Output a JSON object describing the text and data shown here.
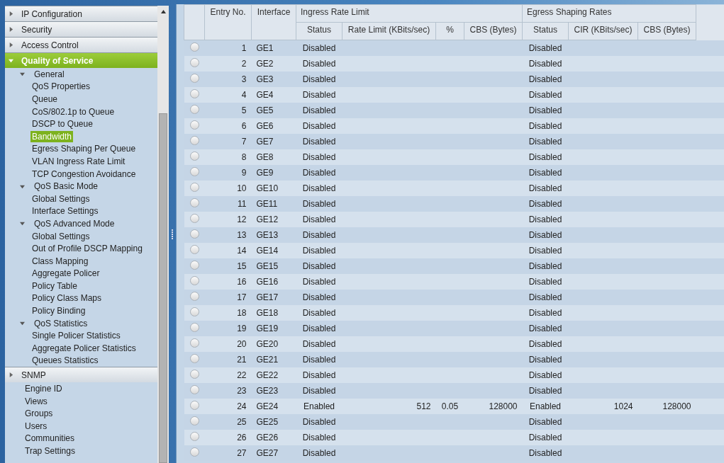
{
  "sidebar": {
    "sections": [
      {
        "label": "IP Configuration",
        "expanded": false,
        "selected": false
      },
      {
        "label": "Security",
        "expanded": false,
        "selected": false
      },
      {
        "label": "Access Control",
        "expanded": false,
        "selected": false
      },
      {
        "label": "Quality of Service",
        "expanded": true,
        "selected": true,
        "items": [
          {
            "label": "General",
            "expanded": true,
            "children": [
              {
                "label": "QoS Properties",
                "selected": false
              },
              {
                "label": "Queue",
                "selected": false
              },
              {
                "label": "CoS/802.1p to Queue",
                "selected": false
              },
              {
                "label": "DSCP to Queue",
                "selected": false
              },
              {
                "label": "Bandwidth",
                "selected": true
              },
              {
                "label": "Egress Shaping Per Queue",
                "selected": false
              },
              {
                "label": "VLAN Ingress Rate Limit",
                "selected": false
              },
              {
                "label": "TCP Congestion Avoidance",
                "selected": false
              }
            ]
          },
          {
            "label": "QoS Basic Mode",
            "expanded": true,
            "children": [
              {
                "label": "Global Settings",
                "selected": false
              },
              {
                "label": "Interface Settings",
                "selected": false
              }
            ]
          },
          {
            "label": "QoS Advanced Mode",
            "expanded": true,
            "children": [
              {
                "label": "Global Settings",
                "selected": false
              },
              {
                "label": "Out of Profile DSCP Mapping",
                "selected": false
              },
              {
                "label": "Class Mapping",
                "selected": false
              },
              {
                "label": "Aggregate Policer",
                "selected": false
              },
              {
                "label": "Policy Table",
                "selected": false
              },
              {
                "label": "Policy Class Maps",
                "selected": false
              },
              {
                "label": "Policy Binding",
                "selected": false
              }
            ]
          },
          {
            "label": "QoS Statistics",
            "expanded": true,
            "children": [
              {
                "label": "Single Policer Statistics",
                "selected": false
              },
              {
                "label": "Aggregate Policer Statistics",
                "selected": false
              },
              {
                "label": "Queues Statistics",
                "selected": false
              }
            ]
          }
        ]
      },
      {
        "label": "SNMP",
        "expanded": false,
        "selected": false,
        "items": [
          {
            "label": "Engine ID",
            "selected": false
          },
          {
            "label": "Views",
            "selected": false
          },
          {
            "label": "Groups",
            "selected": false
          },
          {
            "label": "Users",
            "selected": false
          },
          {
            "label": "Communities",
            "selected": false
          },
          {
            "label": "Trap Settings",
            "selected": false
          }
        ]
      }
    ]
  },
  "table": {
    "columns": [
      "Entry No.",
      "Interface"
    ],
    "groups": [
      {
        "label": "Ingress Rate Limit",
        "columns": [
          "Status",
          "Rate Limit (KBits/sec)",
          "%",
          "CBS (Bytes)"
        ]
      },
      {
        "label": "Egress Shaping Rates",
        "columns": [
          "Status",
          "CIR (KBits/sec)",
          "CBS (Bytes)"
        ]
      }
    ],
    "rows": [
      {
        "selected": false,
        "entry": "1",
        "interface": "GE1",
        "ingress_status": "Disabled",
        "egress_status": "Disabled"
      },
      {
        "selected": false,
        "entry": "2",
        "interface": "GE2",
        "ingress_status": "Disabled",
        "egress_status": "Disabled"
      },
      {
        "selected": false,
        "entry": "3",
        "interface": "GE3",
        "ingress_status": "Disabled",
        "egress_status": "Disabled"
      },
      {
        "selected": false,
        "entry": "4",
        "interface": "GE4",
        "ingress_status": "Disabled",
        "egress_status": "Disabled"
      },
      {
        "selected": false,
        "entry": "5",
        "interface": "GE5",
        "ingress_status": "Disabled",
        "egress_status": "Disabled"
      },
      {
        "selected": false,
        "entry": "6",
        "interface": "GE6",
        "ingress_status": "Disabled",
        "egress_status": "Disabled"
      },
      {
        "selected": false,
        "entry": "7",
        "interface": "GE7",
        "ingress_status": "Disabled",
        "egress_status": "Disabled"
      },
      {
        "selected": false,
        "entry": "8",
        "interface": "GE8",
        "ingress_status": "Disabled",
        "egress_status": "Disabled"
      },
      {
        "selected": false,
        "entry": "9",
        "interface": "GE9",
        "ingress_status": "Disabled",
        "egress_status": "Disabled"
      },
      {
        "selected": false,
        "entry": "10",
        "interface": "GE10",
        "ingress_status": "Disabled",
        "egress_status": "Disabled"
      },
      {
        "selected": false,
        "entry": "11",
        "interface": "GE11",
        "ingress_status": "Disabled",
        "egress_status": "Disabled"
      },
      {
        "selected": false,
        "entry": "12",
        "interface": "GE12",
        "ingress_status": "Disabled",
        "egress_status": "Disabled"
      },
      {
        "selected": false,
        "entry": "13",
        "interface": "GE13",
        "ingress_status": "Disabled",
        "egress_status": "Disabled"
      },
      {
        "selected": false,
        "entry": "14",
        "interface": "GE14",
        "ingress_status": "Disabled",
        "egress_status": "Disabled"
      },
      {
        "selected": false,
        "entry": "15",
        "interface": "GE15",
        "ingress_status": "Disabled",
        "egress_status": "Disabled"
      },
      {
        "selected": false,
        "entry": "16",
        "interface": "GE16",
        "ingress_status": "Disabled",
        "egress_status": "Disabled"
      },
      {
        "selected": false,
        "entry": "17",
        "interface": "GE17",
        "ingress_status": "Disabled",
        "egress_status": "Disabled"
      },
      {
        "selected": false,
        "entry": "18",
        "interface": "GE18",
        "ingress_status": "Disabled",
        "egress_status": "Disabled"
      },
      {
        "selected": false,
        "entry": "19",
        "interface": "GE19",
        "ingress_status": "Disabled",
        "egress_status": "Disabled"
      },
      {
        "selected": false,
        "entry": "20",
        "interface": "GE20",
        "ingress_status": "Disabled",
        "egress_status": "Disabled"
      },
      {
        "selected": false,
        "entry": "21",
        "interface": "GE21",
        "ingress_status": "Disabled",
        "egress_status": "Disabled"
      },
      {
        "selected": false,
        "entry": "22",
        "interface": "GE22",
        "ingress_status": "Disabled",
        "egress_status": "Disabled"
      },
      {
        "selected": false,
        "entry": "23",
        "interface": "GE23",
        "ingress_status": "Disabled",
        "egress_status": "Disabled"
      },
      {
        "selected": false,
        "entry": "24",
        "interface": "GE24",
        "ingress_status": "Enabled",
        "rate_limit": "512",
        "percent": "0.05",
        "ingress_cbs": "128000",
        "egress_status": "Enabled",
        "cir": "1024",
        "egress_cbs": "128000"
      },
      {
        "selected": false,
        "entry": "25",
        "interface": "GE25",
        "ingress_status": "Disabled",
        "egress_status": "Disabled"
      },
      {
        "selected": false,
        "entry": "26",
        "interface": "GE26",
        "ingress_status": "Disabled",
        "egress_status": "Disabled"
      },
      {
        "selected": false,
        "entry": "27",
        "interface": "GE27",
        "ingress_status": "Disabled",
        "egress_status": "Disabled"
      }
    ]
  }
}
